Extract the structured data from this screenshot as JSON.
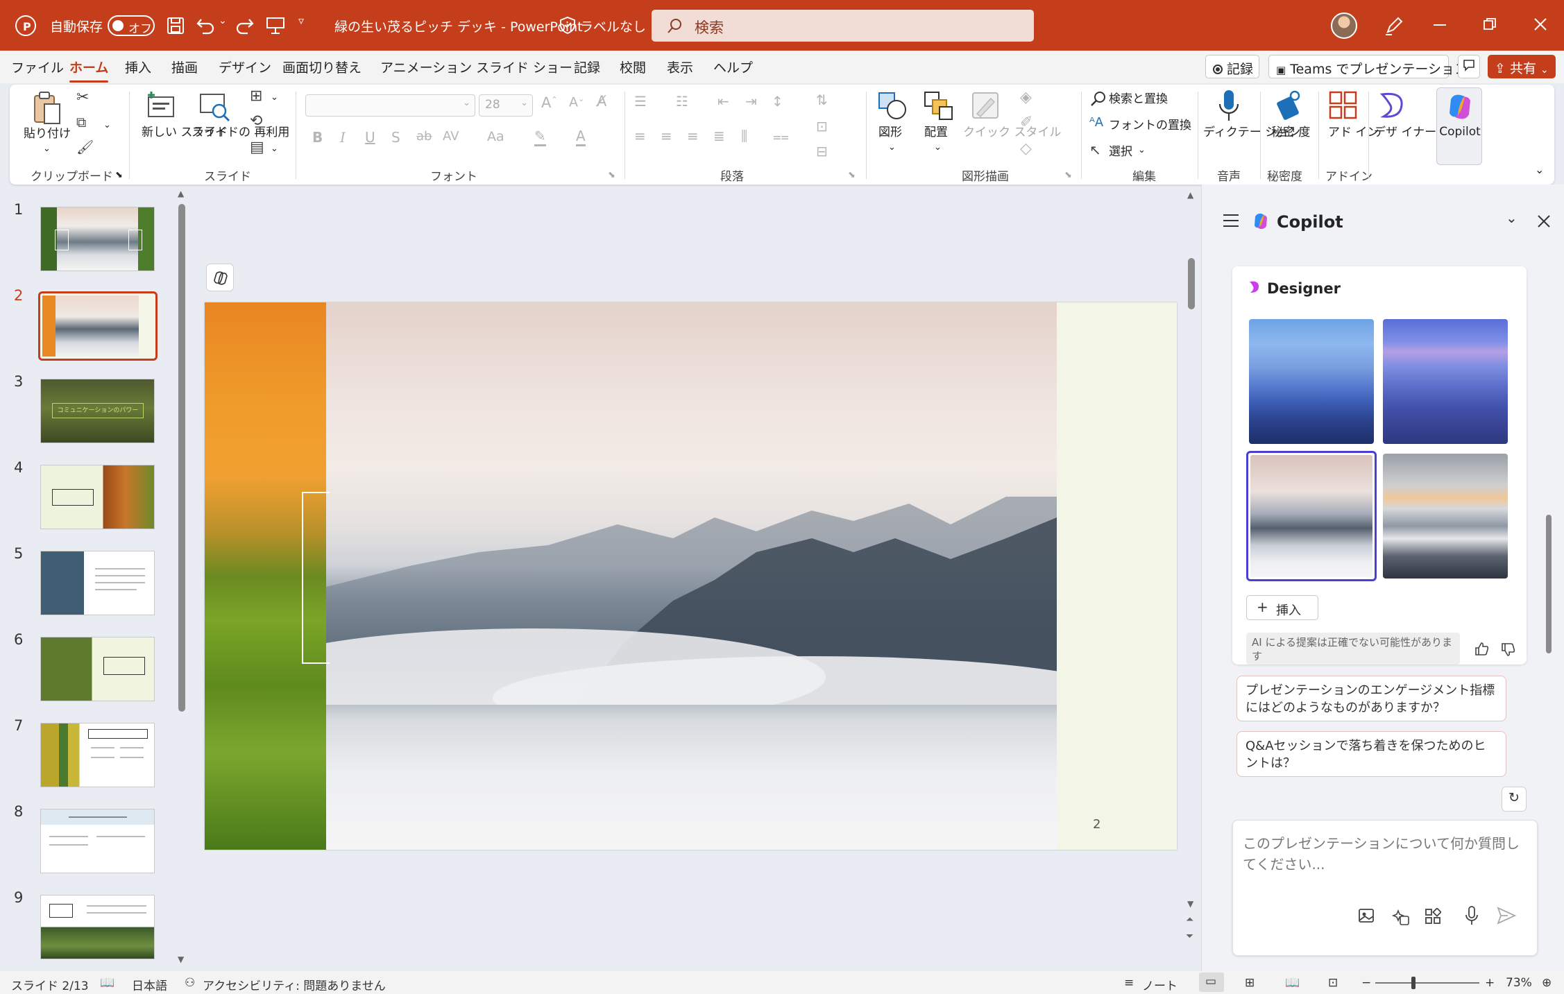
{
  "titlebar": {
    "autosave_label": "自動保存",
    "autosave_state": "オフ",
    "doc_title": "緑の生い茂るピッチ デッキ  -  PowerPoint",
    "sensitivity_label": "ラベルなし",
    "search_placeholder": "検索",
    "accent": "#c43e1c"
  },
  "menu": {
    "tabs": [
      "ファイル",
      "ホーム",
      "挿入",
      "描画",
      "デザイン",
      "画面切り替え",
      "アニメーション",
      "スライド ショー",
      "記録",
      "校閲",
      "表示",
      "ヘルプ"
    ],
    "active_tab": "ホーム",
    "record_label": "記録",
    "teams_label": "Teams でプレゼンテーション",
    "share_label": "共有"
  },
  "ribbon": {
    "paste_label": "貼り付け",
    "new_slide_label": "新しい スライド",
    "reuse_slide_label": "スライドの 再利用",
    "font_size": "28",
    "case_label": "Aa",
    "shapes_label": "図形",
    "arrange_label": "配置",
    "quick_styles_label": "クイック スタイル",
    "find_replace_label": "検索と置換",
    "font_replace_label": "フォントの置換",
    "select_label": "選択",
    "dictate_label": "ディクテー ション",
    "sensitivity_label": "秘密 度",
    "addin_label": "アド イン",
    "designer_label": "デザ イナー",
    "copilot_label": "Copilot",
    "groups": {
      "clipboard": "クリップボード",
      "slides": "スライド",
      "font": "フォント",
      "paragraph": "段落",
      "drawing": "図形描画",
      "editing": "編集",
      "voice": "音声",
      "sensitivity": "秘密度",
      "addins": "アドイン"
    }
  },
  "thumbnails": {
    "numbers": [
      "1",
      "2",
      "3",
      "4",
      "5",
      "6",
      "7",
      "8",
      "9"
    ],
    "selected_index": 1,
    "slide3_title": "コミュニケーションのパワー"
  },
  "slide": {
    "page_number": "2"
  },
  "copilot": {
    "title": "Copilot",
    "designer_title": "Designer",
    "insert_label": "挿入",
    "disclaimer": "AI による提案は正確でない可能性があります",
    "suggestions": [
      "プレゼンテーションのエンゲージメント指標にはどのようなものがありますか？",
      "Q&Aセッションで落ち着きを保つためのヒントは？"
    ],
    "input_placeholder": "このプレゼンテーションについて何か質問してください..."
  },
  "status": {
    "slide_indicator": "スライド 2/13",
    "language": "日本語",
    "accessibility": "アクセシビリティ: 問題ありません",
    "notes_label": "ノート",
    "zoom": "73%"
  }
}
